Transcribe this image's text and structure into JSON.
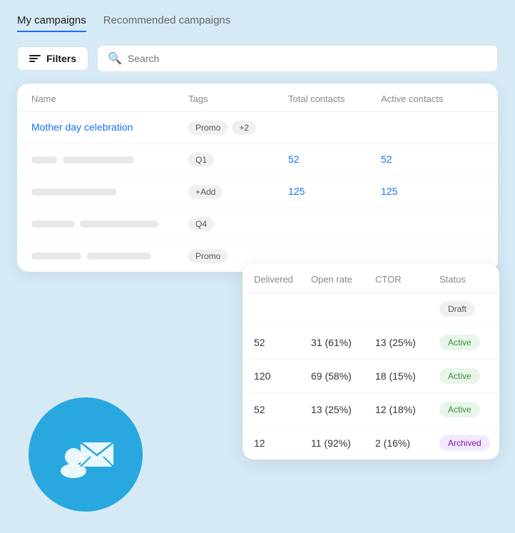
{
  "tabs": [
    {
      "id": "my-campaigns",
      "label": "My campaigns",
      "active": true
    },
    {
      "id": "recommended",
      "label": "Recommended campaigns",
      "active": false
    }
  ],
  "toolbar": {
    "filters_label": "Filters",
    "search_placeholder": "Search"
  },
  "main_table": {
    "headers": [
      "Name",
      "Tags",
      "Total contacts",
      "Active contacts"
    ],
    "rows": [
      {
        "name": "Mother day celebration",
        "tags": [
          "Promo",
          "+2"
        ],
        "total_contacts": null,
        "active_contacts": null,
        "placeholder": false
      },
      {
        "name": null,
        "tags": [
          "Q1"
        ],
        "total_contacts": "52",
        "active_contacts": "52",
        "placeholder": true
      },
      {
        "name": null,
        "tags": [
          "+Add"
        ],
        "total_contacts": "125",
        "active_contacts": "125",
        "placeholder": true
      },
      {
        "name": null,
        "tags": [
          "Q4"
        ],
        "total_contacts": null,
        "active_contacts": null,
        "placeholder": true
      },
      {
        "name": null,
        "tags": [
          "Promo"
        ],
        "total_contacts": null,
        "active_contacts": null,
        "placeholder": true
      }
    ]
  },
  "floating_table": {
    "headers": [
      "Delivered",
      "Open rate",
      "CTOR",
      "Status"
    ],
    "rows": [
      {
        "delivered": "",
        "open_rate": "",
        "ctor": "",
        "status": "Draft",
        "status_type": "draft"
      },
      {
        "delivered": "52",
        "open_rate": "31 (61%)",
        "ctor": "13 (25%)",
        "status": "Active",
        "status_type": "active"
      },
      {
        "delivered": "120",
        "open_rate": "69 (58%)",
        "ctor": "18 (15%)",
        "status": "Active",
        "status_type": "active"
      },
      {
        "delivered": "52",
        "open_rate": "13 (25%)",
        "ctor": "12 (18%)",
        "status": "Active",
        "status_type": "active"
      },
      {
        "delivered": "12",
        "open_rate": "11 (92%)",
        "ctor": "2 (16%)",
        "status": "Archived",
        "status_type": "archived"
      }
    ]
  }
}
